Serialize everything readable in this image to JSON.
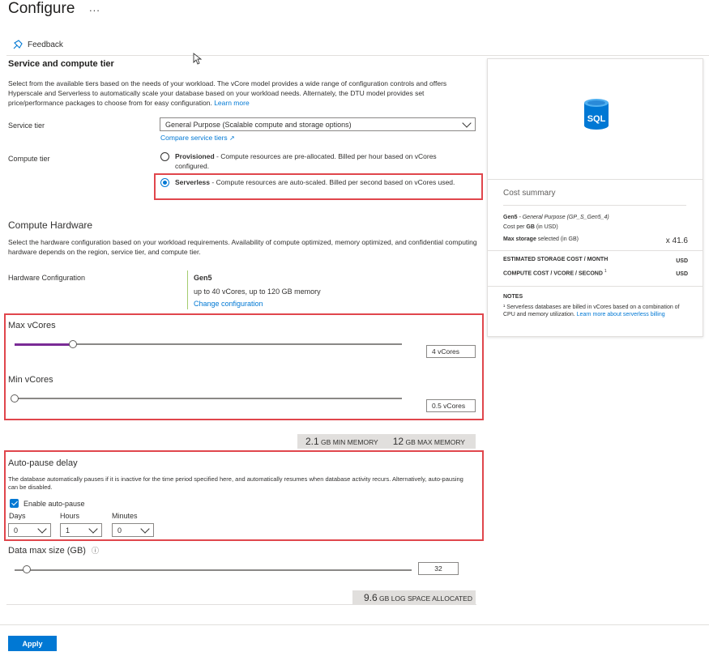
{
  "page": {
    "title": "Configure",
    "more": "...",
    "feedback": "Feedback"
  },
  "service": {
    "heading": "Service and compute tier",
    "description": "Select from the available tiers based on the needs of your workload. The vCore model provides a wide range of configuration controls and offers Hyperscale and Serverless to automatically scale your database based on your workload needs. Alternately, the DTU model provides set price/performance packages to choose from for easy configuration.",
    "learn_more": "Learn more",
    "tier_label": "Service tier",
    "tier_value": "General Purpose (Scalable compute and storage options)",
    "compare": "Compare service tiers",
    "compute_label": "Compute tier",
    "provisioned_title": "Provisioned",
    "provisioned_desc": " - Compute resources are pre-allocated. Billed per hour based on vCores configured.",
    "serverless_title": "Serverless",
    "serverless_desc": " - Compute resources are auto-scaled. Billed per second based on vCores used.",
    "selected_compute": "Serverless"
  },
  "hardware": {
    "heading": "Compute Hardware",
    "description": "Select the hardware configuration based on your workload requirements. Availability of compute optimized, memory optimized, and confidential computing hardware depends on the region, service tier, and compute tier.",
    "label": "Hardware Configuration",
    "gen": "Gen5",
    "specs": "up to 40 vCores, up to 120 GB memory",
    "change": "Change configuration"
  },
  "vcores": {
    "max_label": "Max vCores",
    "max_value": "4 vCores",
    "max_level": 0.15,
    "min_label": "Min vCores",
    "min_value": "0.5 vCores",
    "min_level": 0.0,
    "min_memory_num": "2.1",
    "min_memory_text": " GB MIN MEMORY",
    "max_memory_num": "12",
    "max_memory_text": " GB MAX MEMORY"
  },
  "autopause": {
    "heading": "Auto-pause delay",
    "description": "The database automatically pauses if it is inactive for the time period specified here, and automatically resumes when database activity recurs. Alternatively, auto-pausing can be disabled.",
    "enable_label": "Enable auto-pause",
    "enabled": true,
    "days_label": "Days",
    "days_value": "0",
    "hours_label": "Hours",
    "hours_value": "1",
    "minutes_label": "Minutes",
    "minutes_value": "0"
  },
  "datasize": {
    "label": "Data max size (GB)",
    "info": "ⓘ",
    "value": "32",
    "level": 0.03,
    "log_num": "9.6",
    "log_text": " GB LOG SPACE ALLOCATED"
  },
  "summary": {
    "icon_text": "SQL",
    "heading": "Cost summary",
    "gen": "Gen5",
    "gen_detail": " - General Purpose (GP_S_Gen5_4)",
    "cost_per_gb_a": "Cost per ",
    "cost_per_gb_b": "GB",
    "cost_per_gb_c": " (in USD)",
    "max_storage_a": "Max storage",
    "max_storage_b": " selected (in GB)",
    "max_storage_value": "x 41.6",
    "storage_cost": "ESTIMATED STORAGE COST / MONTH",
    "storage_cost_unit": "USD",
    "compute_cost": "COMPUTE COST / VCORE / SECOND",
    "compute_cost_sup": "1",
    "compute_cost_unit": "USD",
    "notes_heading": "NOTES",
    "note_text": "¹ Serverless databases are billed in vCores based on a combination of CPU and memory utilization. ",
    "note_link": "Learn more about serverless billing"
  },
  "footer": {
    "apply": "Apply"
  },
  "colors": {
    "accent": "#0078d4",
    "highlight": "#e0464c",
    "slider_fill": "#7a2b96"
  }
}
